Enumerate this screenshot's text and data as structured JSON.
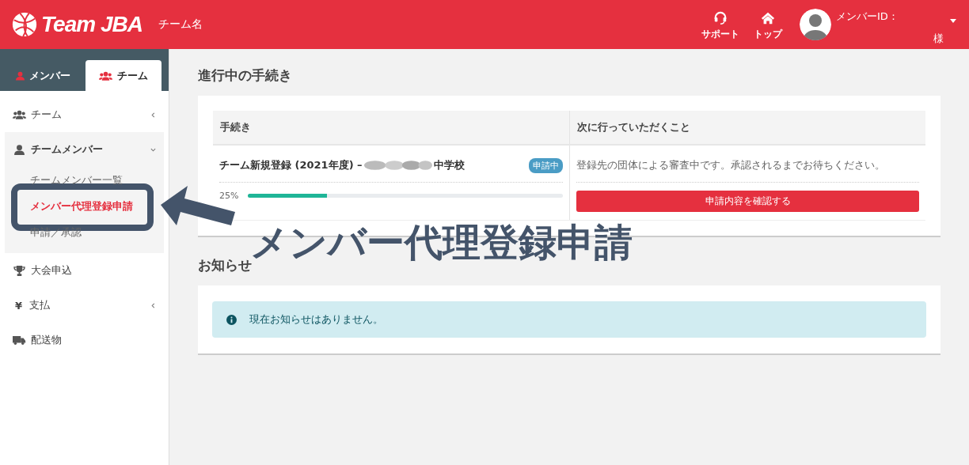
{
  "header": {
    "logo_text": "Team JBA",
    "team_name": "チーム名",
    "nav": [
      {
        "kind": "support",
        "label": "サポート"
      },
      {
        "kind": "home",
        "label": "トップ"
      }
    ],
    "user": {
      "id_label": "メンバーID：",
      "honorific": "様"
    }
  },
  "sidebar": {
    "tabs": [
      {
        "kind": "user",
        "label": "メンバー",
        "selected": false
      },
      {
        "kind": "users",
        "label": "チーム",
        "selected": true
      }
    ],
    "menu": [
      {
        "kind": "users",
        "label": "チーム",
        "expanded": false,
        "collapsible": true
      },
      {
        "kind": "user",
        "label": "チームメンバー",
        "expanded": true,
        "collapsible": true,
        "children": [
          {
            "label": "チームメンバー一覧",
            "selected": false
          },
          {
            "label": "メンバー代理登録申請",
            "selected": true
          },
          {
            "label": "申請／承認",
            "selected": false
          }
        ]
      },
      {
        "kind": "trophy",
        "label": "大会申込",
        "expanded": false,
        "collapsible": false
      },
      {
        "kind": "text",
        "icon_text": "¥",
        "label": "支払",
        "expanded": false,
        "collapsible": true
      },
      {
        "kind": "truck",
        "label": "配送物",
        "expanded": false,
        "collapsible": false
      }
    ]
  },
  "procedures": {
    "title": "進行中の手続き",
    "columns": [
      "手続き",
      "次に行っていただくこと"
    ],
    "rows": [
      {
        "title_prefix": "チーム新規登録 (2021年度) – ",
        "title_suffix": "中学校",
        "badge": "申請中",
        "level": 0.25,
        "reading": "25%",
        "next_step": "登録先の団体による審査中です。承認されるまでお待ちください。",
        "action": "申請内容を確認する"
      }
    ]
  },
  "notices": {
    "title": "お知らせ",
    "message": "現在お知らせはありません。"
  },
  "annotation": {
    "label": "メンバー代理登録申請"
  }
}
